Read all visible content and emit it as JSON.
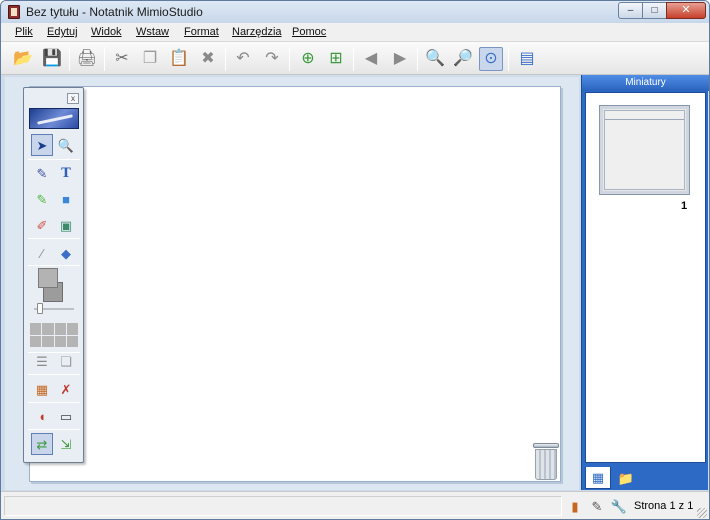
{
  "window": {
    "title": "Bez tytułu - Notatnik MimioStudio",
    "minimize_glyph": "–",
    "maximize_glyph": "□",
    "close_glyph": "✕"
  },
  "menu": {
    "items": [
      {
        "label": "Plik"
      },
      {
        "label": "Edytuj"
      },
      {
        "label": "Widok"
      },
      {
        "label": "Wstaw"
      },
      {
        "label": "Format"
      },
      {
        "label": "Narzędzia"
      },
      {
        "label": "Pomoc"
      }
    ]
  },
  "toolbar": {
    "icons": {
      "open": "📂",
      "save": "💾",
      "print": "🖨",
      "cut": "✂",
      "copy": "❐",
      "paste": "📋",
      "delete": "✖",
      "undo": "↶",
      "redo": "↷",
      "new_page": "⊕",
      "new_pages": "⊞",
      "back": "◀",
      "forward": "▶",
      "zoom_in": "🔍",
      "zoom_out": "🔎",
      "zoom_fit": "⊙",
      "view": "▤"
    },
    "colors": {
      "green": "#3c9a3c",
      "red": "#b0403b",
      "blue": "#3b6fc7",
      "gray": "#6a6a6a"
    }
  },
  "palette": {
    "close_glyph": "x",
    "icons": {
      "select": "➤",
      "zoom": "🔍",
      "pen": "✎",
      "text": "T",
      "highlighter": "✎",
      "shape": "■",
      "eraser": "✐",
      "image": "▣",
      "dropper": "⁄",
      "fill": "◆",
      "lines": "☰",
      "layers": "❏",
      "gallery": "▦",
      "screen_tool": "✗",
      "mouse": "◖",
      "record": "▭",
      "switch": "⇄",
      "export": "⇲"
    }
  },
  "right_panel": {
    "header": "Miniatury",
    "page_number": "1",
    "tabs": {
      "thumbnails_icon": "▦",
      "folder_icon": "📁"
    }
  },
  "status": {
    "page_text": "Strona 1 z 1",
    "icons": {
      "notebook": "▮",
      "pen": "✎",
      "tools": "🔧"
    }
  }
}
